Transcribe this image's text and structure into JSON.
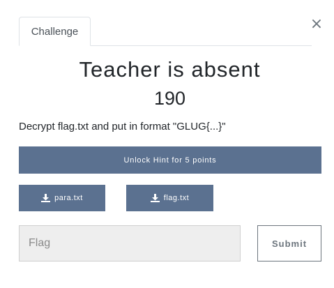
{
  "tabs": [
    {
      "label": "Challenge"
    }
  ],
  "close_glyph": "×",
  "challenge": {
    "name": "Teacher is absent",
    "value": "190",
    "description": "Decrypt flag.txt and put in format \"GLUG{...}\""
  },
  "hint": {
    "label": "Unlock Hint for 5 points"
  },
  "files": [
    {
      "name": "para.txt",
      "icon": "download-icon"
    },
    {
      "name": "flag.txt",
      "icon": "download-icon"
    }
  ],
  "flag_input": {
    "placeholder": "Flag",
    "value": ""
  },
  "submit": {
    "label": "Submit"
  },
  "colors": {
    "button_bg": "#5b7190",
    "input_bg": "#eeeeee"
  }
}
